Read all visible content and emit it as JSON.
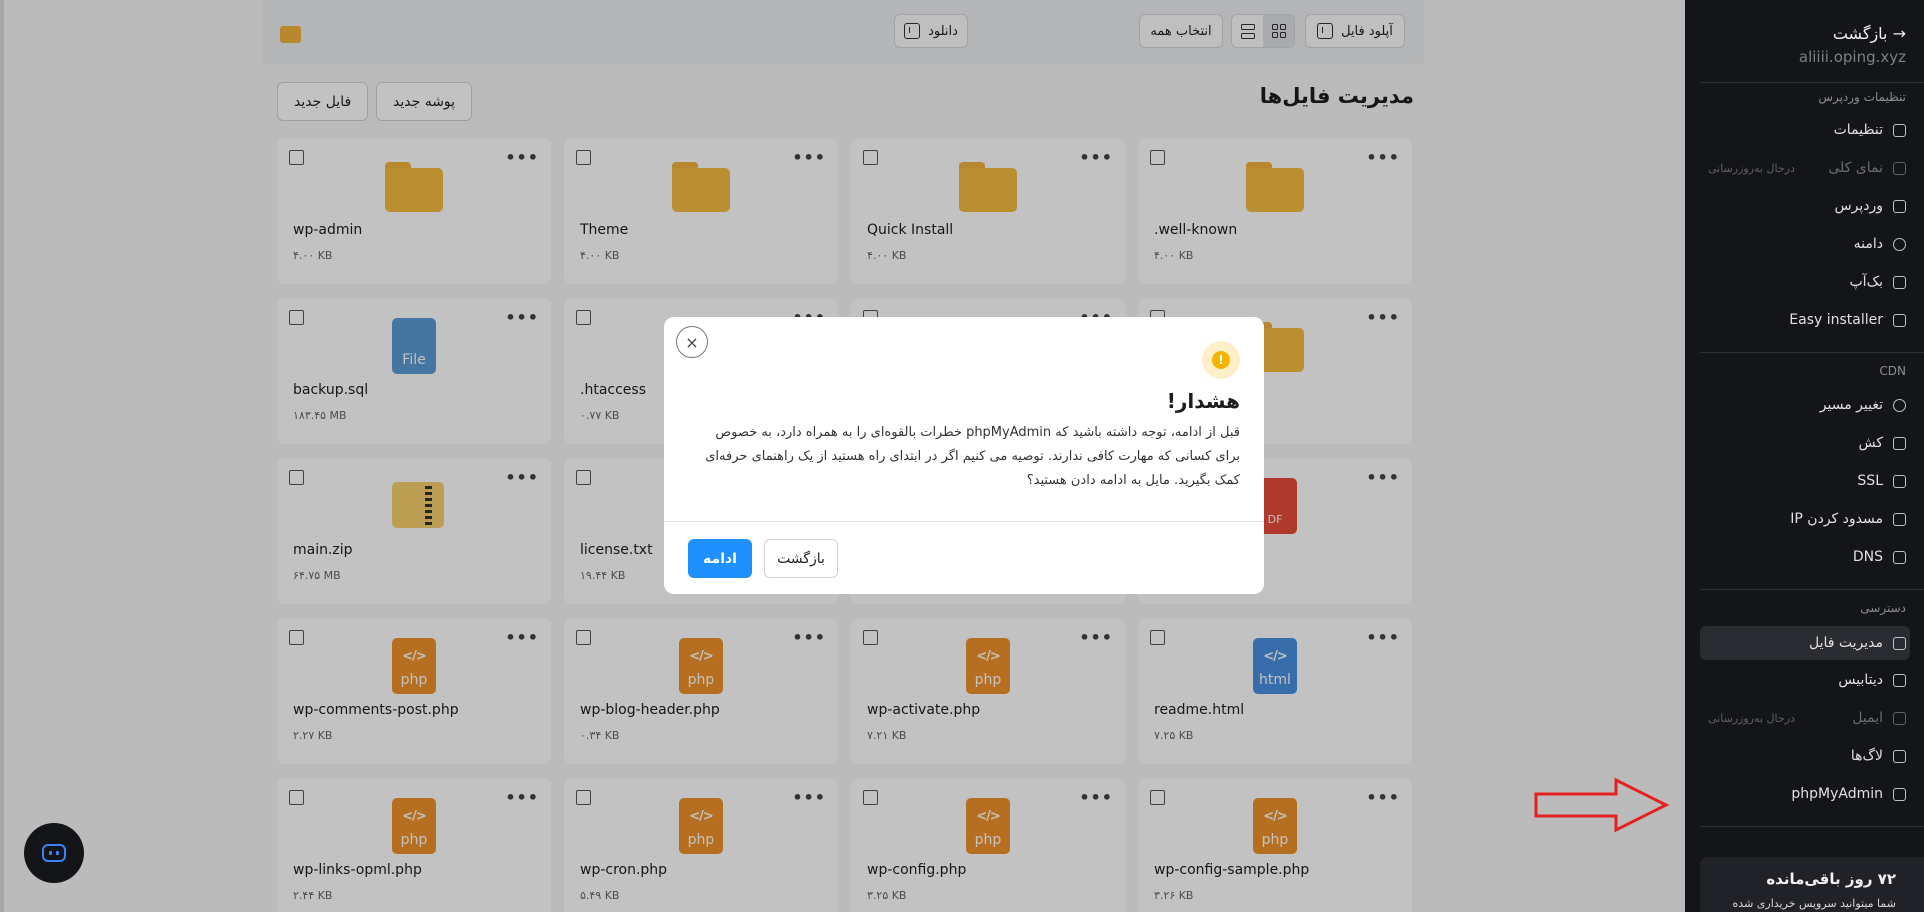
{
  "toolbar": {
    "upload_label": "آپلود فایل",
    "select_all_label": "انتخاب همه",
    "download_label": "دانلود"
  },
  "page": {
    "title": "مدیریت فایل‌ها",
    "new_folder_label": "پوشه جدید",
    "new_file_label": "فایل جدید"
  },
  "files": [
    {
      "name": "wp-admin",
      "size": "۴.۰۰ KB",
      "icon": "folder-icon"
    },
    {
      "name": "Theme",
      "size": "۴.۰۰ KB",
      "icon": "folder-icon"
    },
    {
      "name": "Quick Install",
      "size": "۴.۰۰ KB",
      "icon": "folder-icon"
    },
    {
      "name": ".well-known",
      "size": "۴.۰۰ KB",
      "icon": "folder-icon"
    },
    {
      "name": "backup.sql",
      "size": "۱۸۳.۴۵ MB",
      "icon": "file-icon",
      "icon_label": "File"
    },
    {
      "name": ".htaccess",
      "size": "۰.۷۷ KB",
      "icon": "file-icon"
    },
    {
      "name": "",
      "size": "",
      "icon": "file-icon"
    },
    {
      "name": "",
      "size": "",
      "icon": "folder-icon"
    },
    {
      "name": "main.zip",
      "size": "۶۴.۷۵ MB",
      "icon": "zip-icon"
    },
    {
      "name": "license.txt",
      "size": "۱۹.۴۴ KB",
      "icon": "file-icon"
    },
    {
      "name": "",
      "size": "",
      "icon": "file-icon"
    },
    {
      "name": "",
      "size": "",
      "icon": "pdf-icon",
      "icon_label": "DF"
    },
    {
      "name": "wp-comments-post.php",
      "size": "۲.۲۷ KB",
      "icon": "php-icon",
      "icon_label": "php"
    },
    {
      "name": "wp-blog-header.php",
      "size": "۰.۳۴ KB",
      "icon": "php-icon",
      "icon_label": "php"
    },
    {
      "name": "wp-activate.php",
      "size": "۷.۲۱ KB",
      "icon": "php-icon",
      "icon_label": "php"
    },
    {
      "name": "readme.html",
      "size": "۷.۲۵ KB",
      "icon": "html-icon",
      "icon_label": "html"
    },
    {
      "name": "wp-links-opml.php",
      "size": "۲.۴۴ KB",
      "icon": "php-icon",
      "icon_label": "php"
    },
    {
      "name": "wp-cron.php",
      "size": "۵.۴۹ KB",
      "icon": "php-icon",
      "icon_label": "php"
    },
    {
      "name": "wp-config.php",
      "size": "۳.۲۵ KB",
      "icon": "php-icon",
      "icon_label": "php"
    },
    {
      "name": "wp-config-sample.php",
      "size": "۳.۲۶ KB",
      "icon": "php-icon",
      "icon_label": "php"
    }
  ],
  "sidebar": {
    "back_label": "بازگشت",
    "domain": "aliiii.oping.xyz",
    "sections": {
      "wordpress_settings": "تنظیمات وردپرس",
      "cdn": "CDN",
      "access": "دسترسی"
    },
    "items": {
      "settings": "تنظیمات",
      "overview": "نمای کلی",
      "overview_badge": "درحال به‌روزرسانی",
      "wordpress": "وردپرس",
      "domain": "دامنه",
      "backup": "بک‌آپ",
      "easy_installer": "Easy installer",
      "redirect": "تغییر مسیر",
      "cache": "کش",
      "ssl": "SSL",
      "block_ip": "مسدود کردن IP",
      "dns": "DNS",
      "file_manager": "مدیریت فایل",
      "database": "دیتابیس",
      "email": "ایمیل",
      "email_badge": "درحال به‌روزرسانی",
      "logs": "لاگ‌ها",
      "phpmyadmin": "phpMyAdmin"
    },
    "plan": {
      "days_left": "۷۲ روز باقی‌مانده",
      "note": "شما میتوانید سرویس خریداری شده"
    }
  },
  "modal": {
    "title": "هشدار!",
    "message": "قبل از ادامه، توجه داشته باشید که phpMyAdmin خطرات بالقوه‌ای را به همراه دارد، به خصوص برای کسانی که مهارت کافی ندارند. توصیه می کنیم اگر در ابتدای راه هستید از یک راهنمای حرفه‌ای کمک بگیرید. مایل به ادامه دادن هستید؟",
    "continue_label": "ادامه",
    "back_label": "بازگشت",
    "close_glyph": "×"
  },
  "colors": {
    "accent": "#1e90ff",
    "folder": "#f6bb42",
    "php": "#f0932b",
    "html": "#4a90e2",
    "sidebar_bg": "#141518",
    "warning": "#f5b400",
    "annotation_arrow": "#e62020"
  }
}
